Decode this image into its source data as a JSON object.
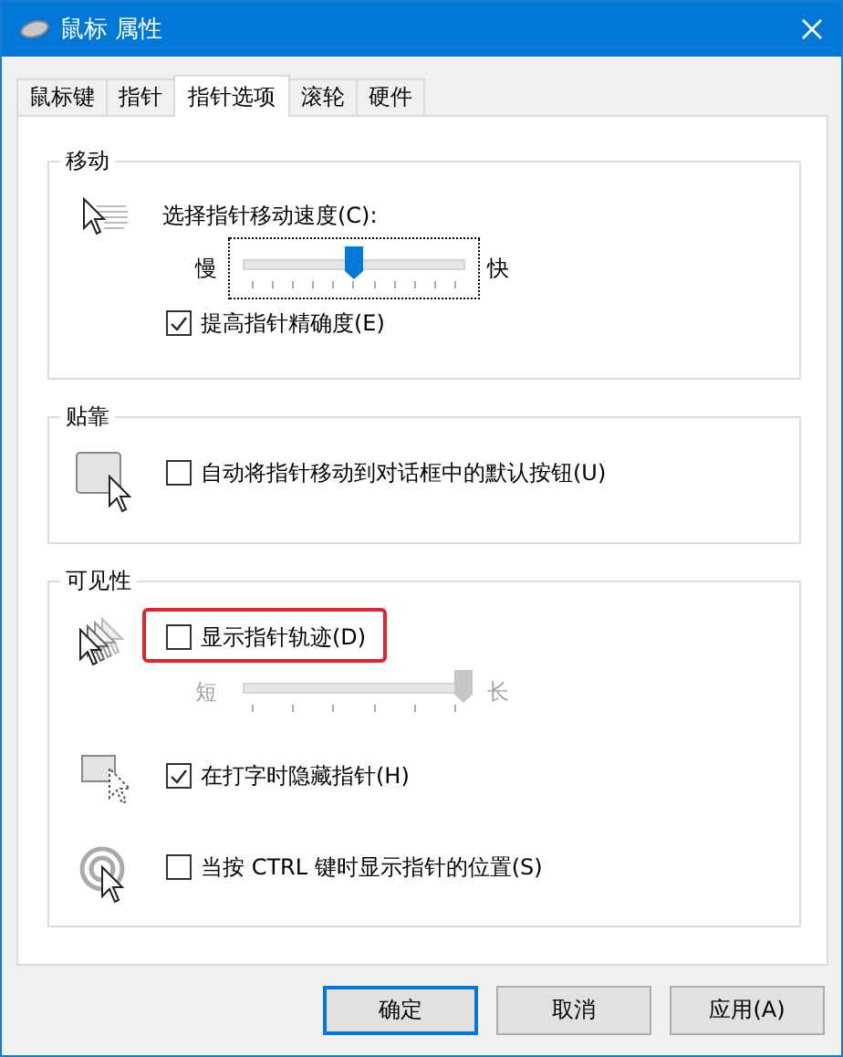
{
  "window": {
    "title": "鼠标 属性"
  },
  "tabs": [
    {
      "label": "鼠标键",
      "selected": false
    },
    {
      "label": "指针",
      "selected": false
    },
    {
      "label": "指针选项",
      "selected": true
    },
    {
      "label": "滚轮",
      "selected": false
    },
    {
      "label": "硬件",
      "selected": false
    }
  ],
  "groups": [
    {
      "title": "移动",
      "blocks": [
        {
          "items": [
            {
              "kind": "label",
              "text": "选择指针移动速度(C):"
            },
            {
              "kind": "slider",
              "min_label": "慢",
              "max_label": "快",
              "level": 0.5,
              "disabled": false
            },
            {
              "kind": "checkbox",
              "label": "提高指针精确度(E)",
              "checked": true,
              "highlighted": false
            }
          ]
        }
      ]
    },
    {
      "title": "贴靠",
      "blocks": [
        {
          "items": [
            {
              "kind": "checkbox",
              "label": "自动将指针移动到对话框中的默认按钮(U)",
              "checked": false,
              "highlighted": false
            }
          ]
        }
      ]
    },
    {
      "title": "可见性",
      "blocks": [
        {
          "items": [
            {
              "kind": "checkbox",
              "label": "显示指针轨迹(D)",
              "checked": false,
              "highlighted": true
            },
            {
              "kind": "slider",
              "min_label": "短",
              "max_label": "长",
              "level": 1.0,
              "disabled": true
            }
          ]
        },
        {
          "items": [
            {
              "kind": "checkbox",
              "label": "在打字时隐藏指针(H)",
              "checked": true,
              "highlighted": false
            }
          ]
        },
        {
          "items": [
            {
              "kind": "checkbox",
              "label": "当按 CTRL 键时显示指针的位置(S)",
              "checked": false,
              "highlighted": false
            }
          ]
        }
      ]
    }
  ],
  "buttons": [
    {
      "label": "确定",
      "default": true
    },
    {
      "label": "取消",
      "default": false
    },
    {
      "label": "应用(A)",
      "default": false
    }
  ]
}
